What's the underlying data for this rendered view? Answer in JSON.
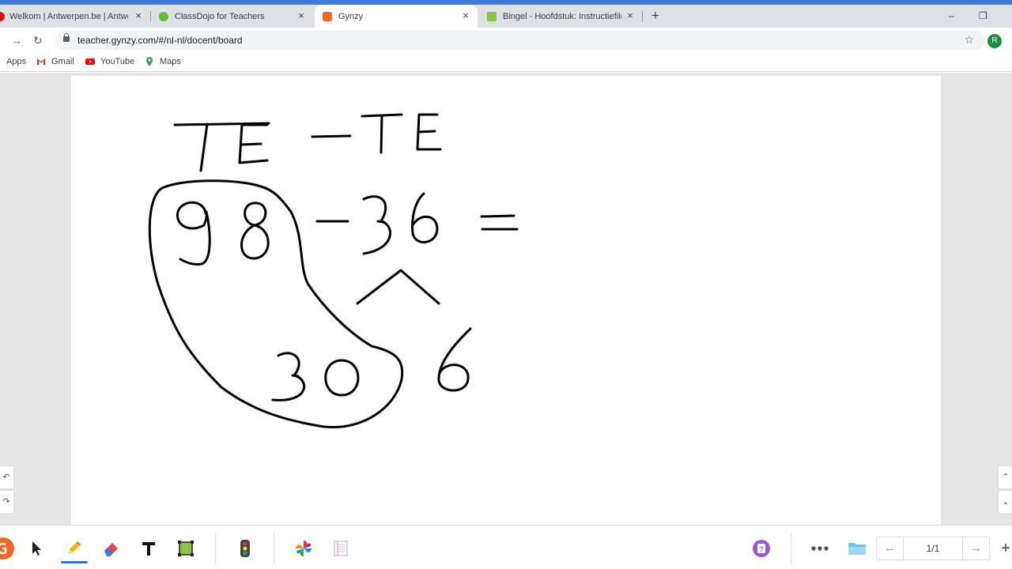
{
  "browser": {
    "tabs": [
      {
        "title": "Welkom | Antwerpen.be | Antwerpen",
        "close": "×",
        "favicon_color": "#e30613"
      },
      {
        "title": "ClassDojo for Teachers",
        "close": "×",
        "favicon_color": "#5bc236"
      },
      {
        "title": "Gynzy",
        "close": "×",
        "favicon_color": "#f26522"
      },
      {
        "title": "Bingel - Hoofdstuk: Instructiefilmpje",
        "close": "×",
        "favicon_color": "#8cc63f"
      }
    ],
    "new_tab": "+",
    "minimize": "–",
    "restore": "❐",
    "url": "teacher.gynzy.com/#/nl-nl/docent/board",
    "profile_initial": "R",
    "bookmarks": [
      {
        "label": "Apps"
      },
      {
        "label": "Gmail"
      },
      {
        "label": "YouTube"
      },
      {
        "label": "Maps"
      }
    ]
  },
  "board": {
    "side_undo": "↶",
    "side_redo": "↷",
    "side_up": "⌃",
    "side_down": "⌄"
  },
  "toolbar": {
    "tools": [
      "gynzy-logo-icon",
      "pointer-icon",
      "pencil-icon",
      "eraser-icon",
      "text-icon",
      "shape-icon",
      "traffic-light-icon",
      "pinwheel-icon",
      "worksheet-icon"
    ],
    "help_icon": "question-icon",
    "more_icon": "more-dots-icon",
    "folder_icon": "folder-icon",
    "page_counter": "1/1",
    "prev": "←",
    "next": "→",
    "add": "+"
  },
  "colors": {
    "accent": "#f26522",
    "help": "#9b59d0",
    "pen_active": "#2f6fd6"
  }
}
